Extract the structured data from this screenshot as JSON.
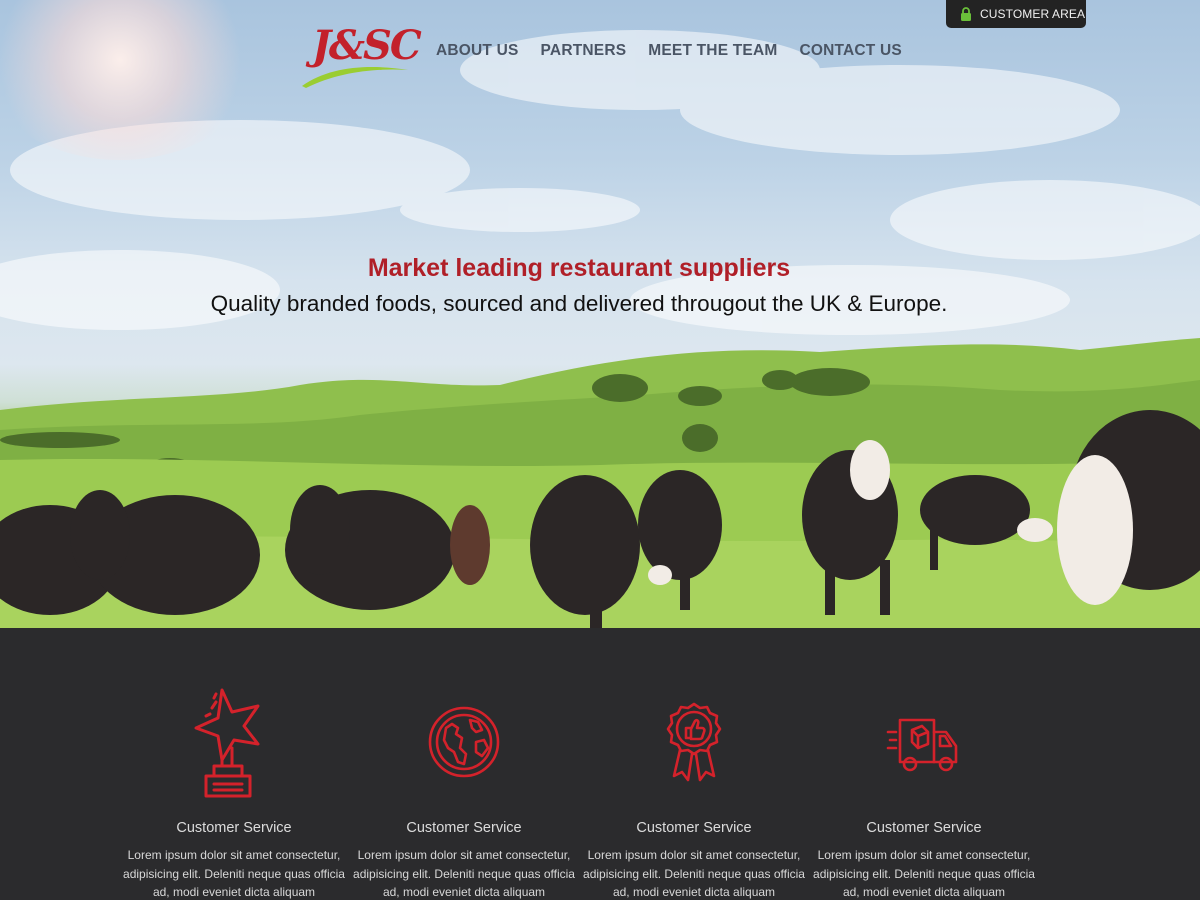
{
  "brand": {
    "logo_text": "J&SC",
    "accent": "#c3212b",
    "swoosh": "#9acd32"
  },
  "header": {
    "nav": [
      {
        "label": "ABOUT US"
      },
      {
        "label": "PARTNERS"
      },
      {
        "label": "MEET THE TEAM"
      },
      {
        "label": "CONTACT US"
      }
    ],
    "customer_area": {
      "label": "CUSTOMER AREA",
      "icon": "lock-icon",
      "icon_color": "#6abf3a"
    }
  },
  "hero": {
    "title": "Market leading restaurant suppliers",
    "subtitle": "Quality branded foods, sourced and delivered througout the UK & Europe."
  },
  "features": [
    {
      "icon": "trophy-star-icon",
      "title": "Customer Service",
      "text": "Lorem ipsum dolor sit amet consectetur, adipisicing elit. Deleniti neque quas officia ad, modi eveniet dicta aliquam"
    },
    {
      "icon": "globe-icon",
      "title": "Customer Service",
      "text": "Lorem ipsum dolor sit amet consectetur, adipisicing elit. Deleniti neque quas officia ad, modi eveniet dicta aliquam"
    },
    {
      "icon": "award-badge-icon",
      "title": "Customer Service",
      "text": "Lorem ipsum dolor sit amet consectetur, adipisicing elit. Deleniti neque quas officia ad, modi eveniet dicta aliquam"
    },
    {
      "icon": "delivery-truck-icon",
      "title": "Customer Service",
      "text": "Lorem ipsum dolor sit amet consectetur, adipisicing elit. Deleniti neque quas officia ad, modi eveniet dicta aliquam"
    }
  ]
}
